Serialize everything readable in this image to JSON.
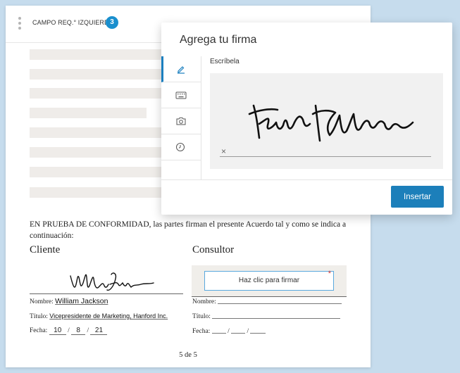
{
  "header": {
    "field_label": "CAMPO REQ.° IZQUIERDO",
    "field_count": "3"
  },
  "document": {
    "clause": "EN PRUEBA DE CONFORMIDAD, las partes firman el presente Acuerdo tal y como se indica a continuación:",
    "client": {
      "heading": "Cliente",
      "name_label": "Nombre:",
      "name_value": "William Jackson",
      "title_label": "Título:",
      "title_value": "Vicepresidente de Marketing, Hanford Inc.",
      "date_label": "Fecha:",
      "date_month": "10",
      "date_day": "8",
      "date_year": "21",
      "date_sep": "/"
    },
    "consultant": {
      "heading": "Consultor",
      "sign_button": "Haz clic para firmar",
      "required_mark": "*",
      "name_label": "Nombre:",
      "title_label": "Título:",
      "date_label": "Fecha:",
      "date_sep": "/"
    },
    "page_number": "5 de 5"
  },
  "modal": {
    "title": "Agrega tu firma",
    "tabs": [
      {
        "icon": "pen-icon",
        "active": true
      },
      {
        "icon": "keyboard-icon",
        "active": false
      },
      {
        "icon": "camera-icon",
        "active": false
      },
      {
        "icon": "clock-icon",
        "active": false
      }
    ],
    "panel_label": "Escríbela",
    "clear_label": "×",
    "insert_button": "Insertar"
  },
  "colors": {
    "page_background": "#c6dced",
    "accent": "#1c7fba",
    "badge": "#1a8fce",
    "required": "#d83a3a"
  }
}
